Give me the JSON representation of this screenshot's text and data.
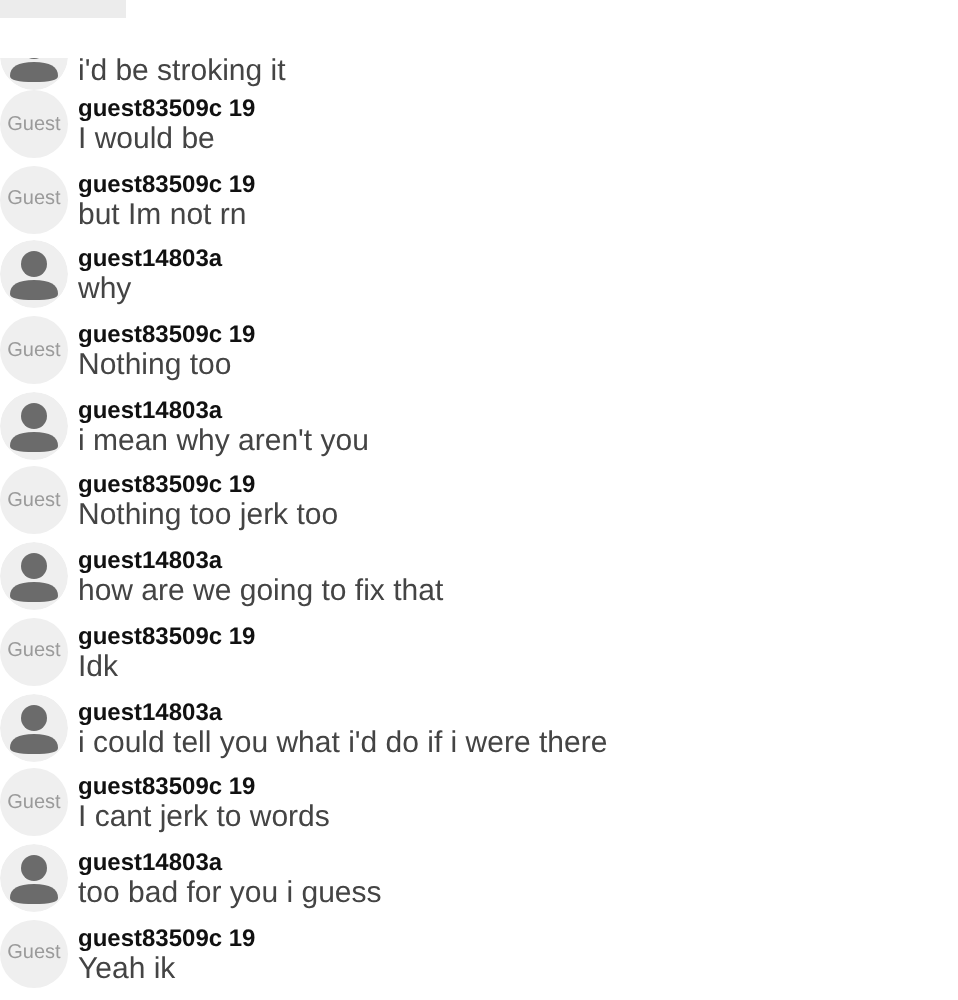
{
  "messages": [
    {
      "kind": "user",
      "text": "i'd be stroking it"
    },
    {
      "kind": "guest",
      "avatar_label": "Guest",
      "name": "guest83509c 19",
      "text": "I would be"
    },
    {
      "kind": "guest",
      "avatar_label": "Guest",
      "name": "guest83509c 19",
      "text": "but Im not rn"
    },
    {
      "kind": "user",
      "name": "guest14803a",
      "text": "why"
    },
    {
      "kind": "guest",
      "avatar_label": "Guest",
      "name": "guest83509c 19",
      "text": "Nothing too"
    },
    {
      "kind": "user",
      "name": "guest14803a",
      "text": "i mean why aren't you"
    },
    {
      "kind": "guest",
      "avatar_label": "Guest",
      "name": "guest83509c 19",
      "text": "Nothing too jerk too"
    },
    {
      "kind": "user",
      "name": "guest14803a",
      "text": "how are we going to fix that"
    },
    {
      "kind": "guest",
      "avatar_label": "Guest",
      "name": "guest83509c 19",
      "text": "Idk"
    },
    {
      "kind": "user",
      "name": "guest14803a",
      "text": "i could tell you what i'd do if i were there"
    },
    {
      "kind": "guest",
      "avatar_label": "Guest",
      "name": "guest83509c 19",
      "text": "I cant jerk to words"
    },
    {
      "kind": "user",
      "name": "guest14803a",
      "text": "too bad for you i guess"
    },
    {
      "kind": "guest",
      "avatar_label": "Guest",
      "name": "guest83509c 19",
      "text": "Yeah ik"
    }
  ]
}
